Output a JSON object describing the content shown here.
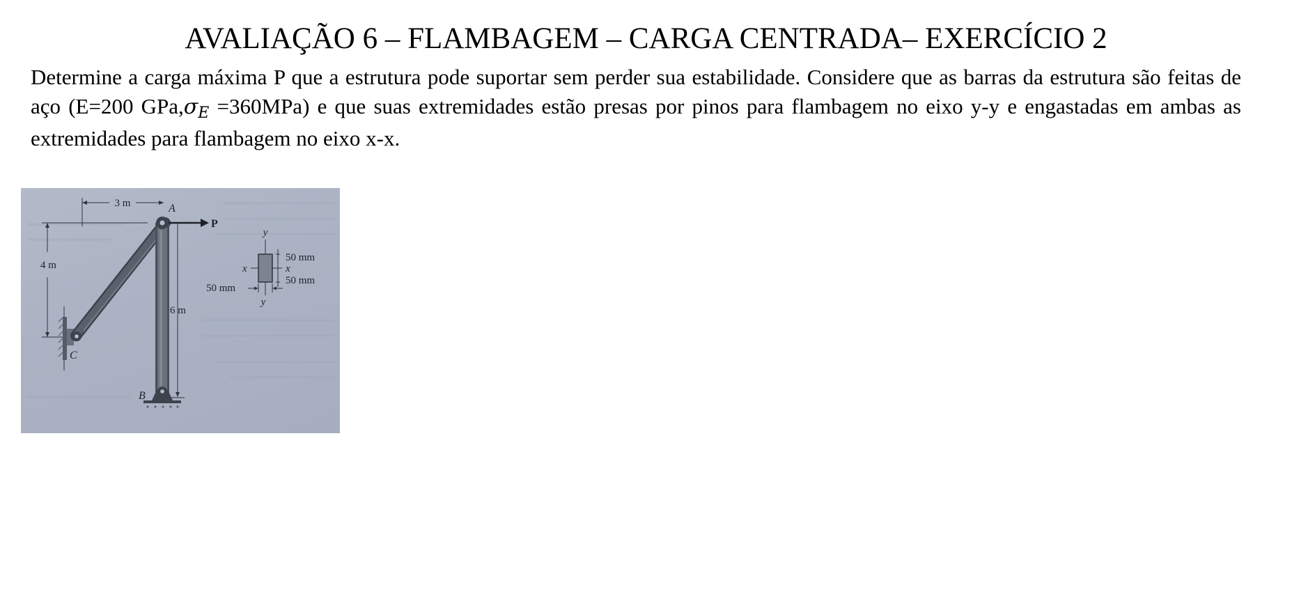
{
  "title": "AVALIAÇÃO 6 – FLAMBAGEM – CARGA CENTRADA– EXERCÍCIO 2",
  "problem": {
    "part1": "Determine a carga máxima P que a estrutura pode suportar sem perder sua estabilidade. Considere que as barras da estrutura são feitas de aço (E=200 GPa,",
    "sigma": "σ",
    "subscript": "E",
    "part2": " =360MPa) e que suas extremidades estão presas por pinos para flambagem no eixo y-y e engastadas em ambas as extremidades para flambagem no eixo x-x."
  },
  "figure": {
    "dim_horizontal": "3 m",
    "dim_left_vertical": "4 m",
    "dim_column": "6 m",
    "point_a": "A",
    "point_b": "B",
    "point_c": "C",
    "load": "P",
    "section": {
      "axis_y_top": "y",
      "axis_y_bottom": "y",
      "axis_x_left": "x",
      "axis_x_right": "x",
      "dim_top": "50 mm",
      "dim_bottom": "50 mm",
      "dim_width": "50 mm"
    }
  }
}
